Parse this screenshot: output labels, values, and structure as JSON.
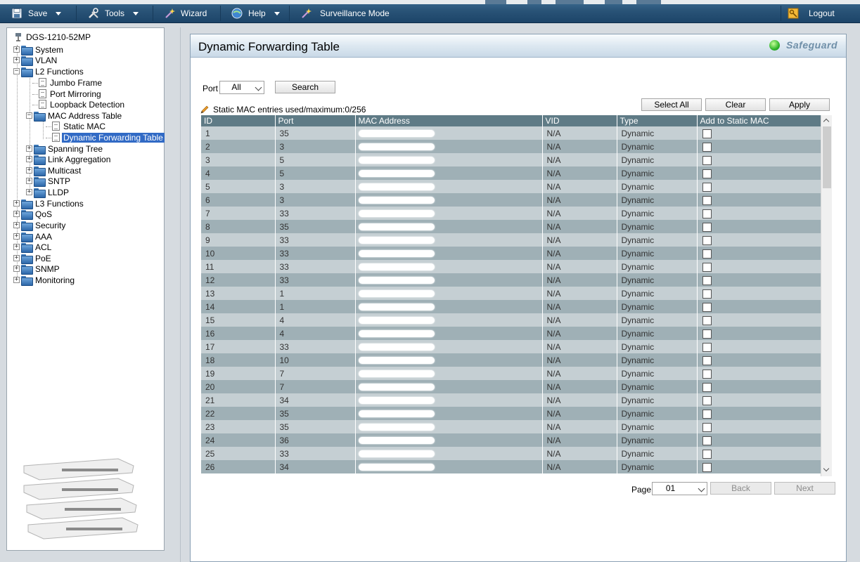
{
  "menubar": {
    "save": "Save",
    "tools": "Tools",
    "wizard": "Wizard",
    "help": "Help",
    "surveillance": "Surveillance Mode",
    "logout": "Logout"
  },
  "tree": {
    "root": "DGS-1210-52MP",
    "items": {
      "system": "System",
      "vlan": "VLAN",
      "l2": "L2 Functions",
      "jumbo": "Jumbo Frame",
      "mirroring": "Port Mirroring",
      "loopback": "Loopback Detection",
      "mactable": "MAC Address Table",
      "staticmac": "Static MAC",
      "dynfwd": "Dynamic Forwarding Table",
      "spanning": "Spanning Tree",
      "linkagg": "Link Aggregation",
      "multicast": "Multicast",
      "sntp": "SNTP",
      "lldp": "LLDP",
      "l3": "L3 Functions",
      "qos": "QoS",
      "security": "Security",
      "aaa": "AAA",
      "acl": "ACL",
      "poe": "PoE",
      "snmp": "SNMP",
      "monitoring": "Monitoring"
    }
  },
  "panel": {
    "title": "Dynamic Forwarding Table",
    "safeguard": "Safeguard",
    "port_label": "Port",
    "port_value": "All",
    "search": "Search",
    "select_all": "Select All",
    "clear": "Clear",
    "apply": "Apply",
    "static_info": "Static MAC entries used/maximum:0/256",
    "page_label": "Page",
    "page_value": "01",
    "back": "Back",
    "next": "Next"
  },
  "table": {
    "headers": [
      "ID",
      "Port",
      "MAC Address",
      "VID",
      "Type",
      "Add to Static MAC"
    ],
    "rows": [
      {
        "id": "1",
        "port": "35",
        "vid": "N/A",
        "type": "Dynamic"
      },
      {
        "id": "2",
        "port": "3",
        "vid": "N/A",
        "type": "Dynamic"
      },
      {
        "id": "3",
        "port": "5",
        "vid": "N/A",
        "type": "Dynamic"
      },
      {
        "id": "4",
        "port": "5",
        "vid": "N/A",
        "type": "Dynamic"
      },
      {
        "id": "5",
        "port": "3",
        "vid": "N/A",
        "type": "Dynamic"
      },
      {
        "id": "6",
        "port": "3",
        "vid": "N/A",
        "type": "Dynamic"
      },
      {
        "id": "7",
        "port": "33",
        "vid": "N/A",
        "type": "Dynamic"
      },
      {
        "id": "8",
        "port": "35",
        "vid": "N/A",
        "type": "Dynamic"
      },
      {
        "id": "9",
        "port": "33",
        "vid": "N/A",
        "type": "Dynamic"
      },
      {
        "id": "10",
        "port": "33",
        "vid": "N/A",
        "type": "Dynamic"
      },
      {
        "id": "11",
        "port": "33",
        "vid": "N/A",
        "type": "Dynamic"
      },
      {
        "id": "12",
        "port": "33",
        "vid": "N/A",
        "type": "Dynamic"
      },
      {
        "id": "13",
        "port": "1",
        "vid": "N/A",
        "type": "Dynamic"
      },
      {
        "id": "14",
        "port": "1",
        "vid": "N/A",
        "type": "Dynamic"
      },
      {
        "id": "15",
        "port": "4",
        "vid": "N/A",
        "type": "Dynamic"
      },
      {
        "id": "16",
        "port": "4",
        "vid": "N/A",
        "type": "Dynamic"
      },
      {
        "id": "17",
        "port": "33",
        "vid": "N/A",
        "type": "Dynamic"
      },
      {
        "id": "18",
        "port": "10",
        "vid": "N/A",
        "type": "Dynamic"
      },
      {
        "id": "19",
        "port": "7",
        "vid": "N/A",
        "type": "Dynamic"
      },
      {
        "id": "20",
        "port": "7",
        "vid": "N/A",
        "type": "Dynamic"
      },
      {
        "id": "21",
        "port": "34",
        "vid": "N/A",
        "type": "Dynamic"
      },
      {
        "id": "22",
        "port": "35",
        "vid": "N/A",
        "type": "Dynamic"
      },
      {
        "id": "23",
        "port": "35",
        "vid": "N/A",
        "type": "Dynamic"
      },
      {
        "id": "24",
        "port": "36",
        "vid": "N/A",
        "type": "Dynamic"
      },
      {
        "id": "25",
        "port": "33",
        "vid": "N/A",
        "type": "Dynamic"
      },
      {
        "id": "26",
        "port": "34",
        "vid": "N/A",
        "type": "Dynamic"
      }
    ]
  }
}
